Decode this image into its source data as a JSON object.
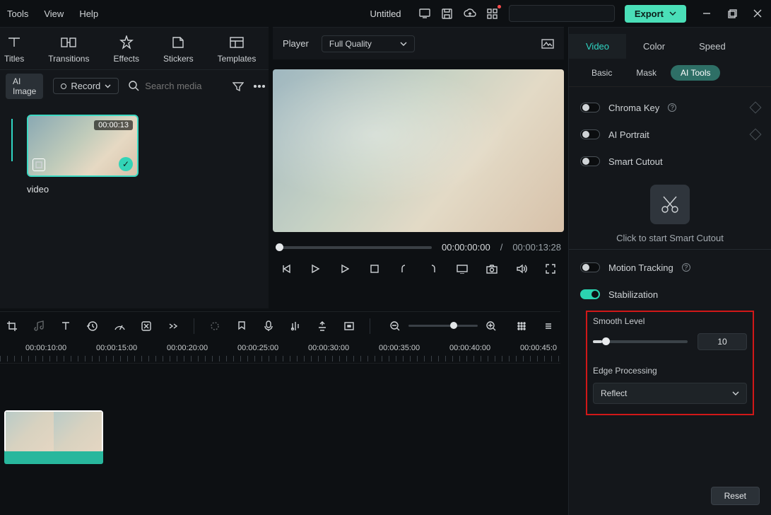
{
  "menubar": {
    "tools": "Tools",
    "view": "View",
    "help": "Help"
  },
  "title": "Untitled",
  "export_label": "Export",
  "asset_tabs": {
    "titles": "Titles",
    "transitions": "Transitions",
    "effects": "Effects",
    "stickers": "Stickers",
    "templates": "Templates"
  },
  "asset_tools": {
    "ai_image": "AI Image",
    "record": "Record",
    "search_placeholder": "Search media"
  },
  "clip": {
    "duration": "00:00:13",
    "name": "video"
  },
  "player": {
    "label": "Player",
    "quality": "Full Quality",
    "current": "00:00:00:00",
    "slash": "/",
    "total": "00:00:13:28"
  },
  "prop_tabs": {
    "video": "Video",
    "color": "Color",
    "speed": "Speed"
  },
  "sub_tabs": {
    "basic": "Basic",
    "mask": "Mask",
    "ai_tools": "AI Tools"
  },
  "props": {
    "chroma": "Chroma Key",
    "portrait": "AI Portrait",
    "smart_cutout": "Smart Cutout",
    "cutout_hint": "Click to start Smart Cutout",
    "motion": "Motion Tracking",
    "stabilization": "Stabilization",
    "smooth_level": "Smooth Level",
    "smooth_value": "10",
    "edge_label": "Edge Processing",
    "edge_value": "Reflect",
    "reset": "Reset"
  },
  "timeline_labels": [
    "00:00:10:00",
    "00:00:15:00",
    "00:00:20:00",
    "00:00:25:00",
    "00:00:30:00",
    "00:00:35:00",
    "00:00:40:00",
    "00:00:45:0"
  ]
}
